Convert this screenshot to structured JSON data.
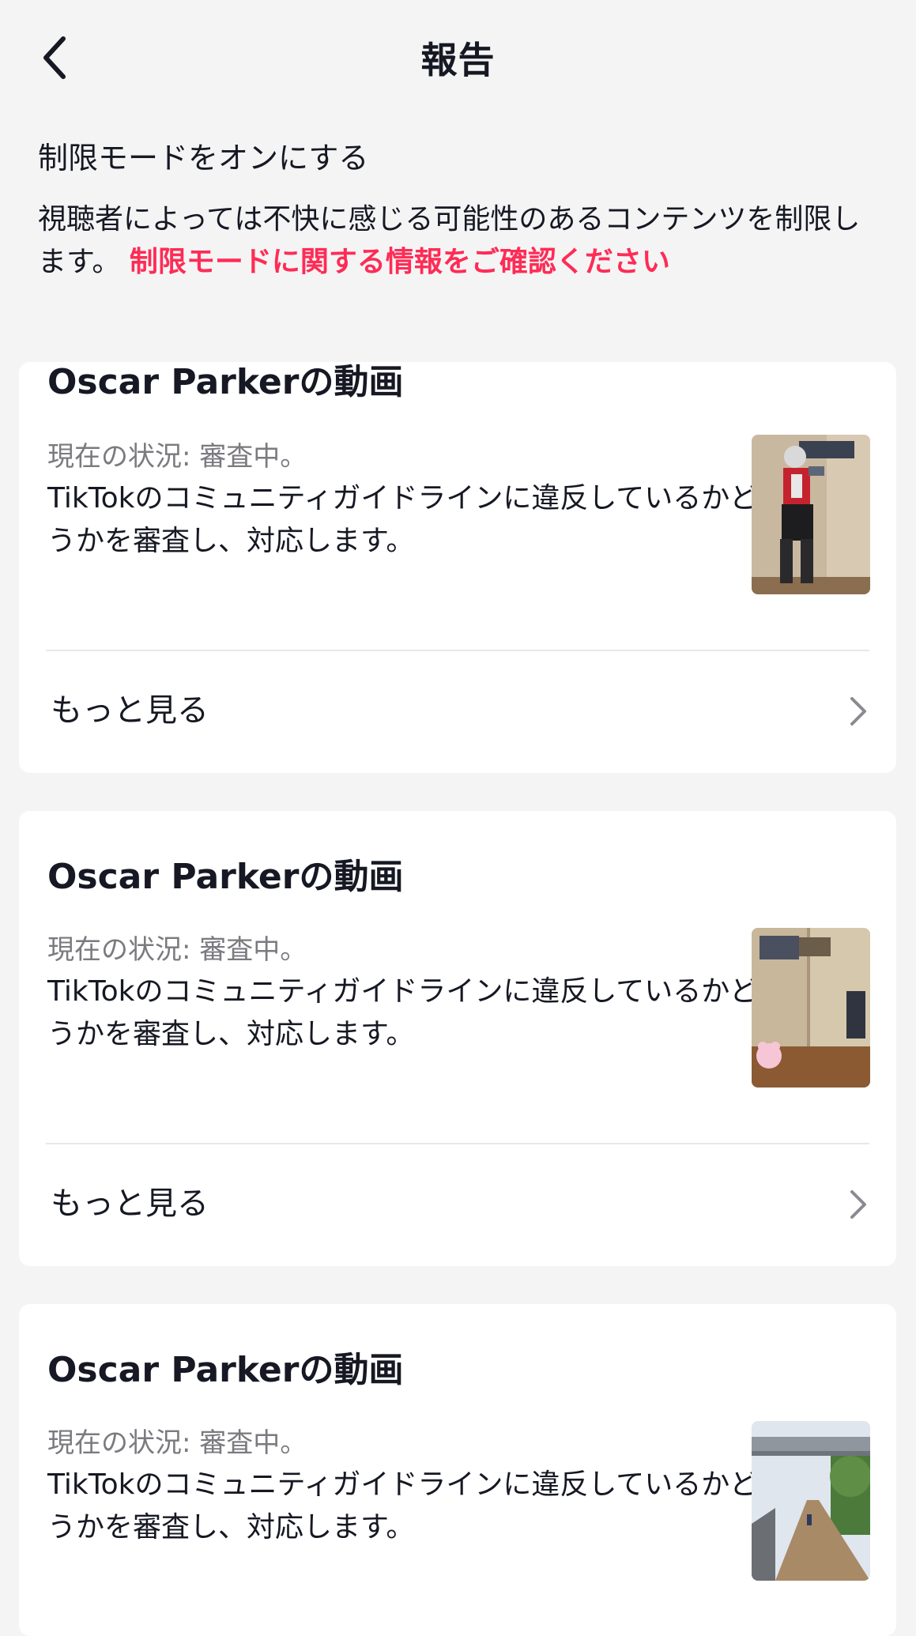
{
  "header": {
    "title": "報告",
    "back_icon": "chevron-left-icon"
  },
  "restricted_mode": {
    "title": "制限モードをオンにする",
    "description": "視聴者によっては不快に感じる可能性のあるコンテンツを制限します。",
    "link": "制限モードに関する情報をご確認ください",
    "link_color": "#fe2c55"
  },
  "reports": [
    {
      "title": "Oscar Parkerの動画",
      "status": "現在の状況: 審査中。",
      "description": "TikTokのコミュニティガイドラインに違反しているかどうかを審査し、対応します。",
      "see_more": "もっと見る"
    },
    {
      "title": "Oscar Parkerの動画",
      "status": "現在の状況: 審査中。",
      "description": "TikTokのコミュニティガイドラインに違反しているかどうかを審査し、対応します。",
      "see_more": "もっと見る"
    },
    {
      "title": "Oscar Parkerの動画",
      "status": "現在の状況: 審査中。",
      "description": "TikTokのコミュニティガイドラインに違反しているかどうかを審査し、対応します。"
    }
  ]
}
